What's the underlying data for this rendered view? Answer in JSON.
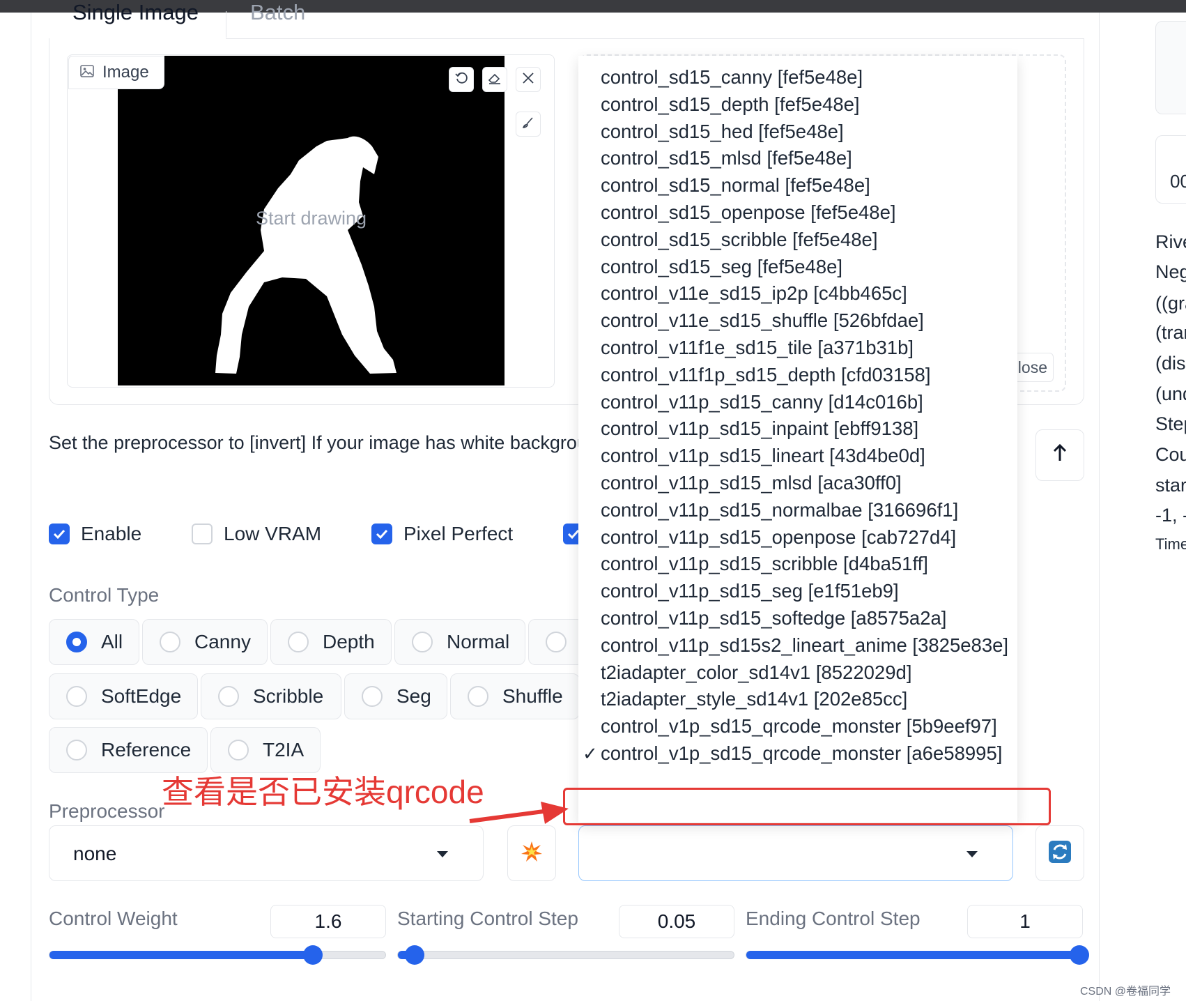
{
  "tabs": {
    "single": "Single Image",
    "batch": "Batch"
  },
  "image_panel": {
    "label": "Image",
    "placeholder": "Start drawing",
    "close_label": "lose"
  },
  "hint": "Set the preprocessor to [invert] If your image has white background and black lines.",
  "checkboxes": [
    {
      "label": "Enable",
      "checked": true
    },
    {
      "label": "Low VRAM",
      "checked": false
    },
    {
      "label": "Pixel Perfect",
      "checked": true
    }
  ],
  "control_type": {
    "label": "Control Type",
    "options": [
      "All",
      "Canny",
      "Depth",
      "Normal",
      "SoftEdge",
      "Scribble",
      "Seg",
      "Shuffle",
      "Reference",
      "T2IA"
    ],
    "selected": "All"
  },
  "preprocessor": {
    "label": "Preprocessor",
    "value": "none"
  },
  "model_dropdown": {
    "items": [
      "control_sd15_canny [fef5e48e]",
      "control_sd15_depth [fef5e48e]",
      "control_sd15_hed [fef5e48e]",
      "control_sd15_mlsd [fef5e48e]",
      "control_sd15_normal [fef5e48e]",
      "control_sd15_openpose [fef5e48e]",
      "control_sd15_scribble [fef5e48e]",
      "control_sd15_seg [fef5e48e]",
      "control_v11e_sd15_ip2p [c4bb465c]",
      "control_v11e_sd15_shuffle [526bfdae]",
      "control_v11f1e_sd15_tile [a371b31b]",
      "control_v11f1p_sd15_depth [cfd03158]",
      "control_v11p_sd15_canny [d14c016b]",
      "control_v11p_sd15_inpaint [ebff9138]",
      "control_v11p_sd15_lineart [43d4be0d]",
      "control_v11p_sd15_mlsd [aca30ff0]",
      "control_v11p_sd15_normalbae [316696f1]",
      "control_v11p_sd15_openpose [cab727d4]",
      "control_v11p_sd15_scribble [d4ba51ff]",
      "control_v11p_sd15_seg [e1f51eb9]",
      "control_v11p_sd15_softedge [a8575a2a]",
      "control_v11p_sd15s2_lineart_anime [3825e83e]",
      "t2iadapter_color_sd14v1 [8522029d]",
      "t2iadapter_style_sd14v1 [202e85cc]",
      "control_v1p_sd15_qrcode_monster [5b9eef97]",
      "control_v1p_sd15_qrcode_monster [a6e58995]"
    ],
    "selected_index": 25,
    "check_mark": "✓"
  },
  "annotation": "查看是否已安装qrcode",
  "sliders": {
    "weight": {
      "label": "Control Weight",
      "value": "1.6",
      "fraction": 0.78
    },
    "start": {
      "label": "Starting Control Step",
      "value": "0.05",
      "fraction": 0.05
    },
    "end": {
      "label": "Ending Control Step",
      "value": "1",
      "fraction": 1.0
    }
  },
  "right_panel": {
    "card_text": "00",
    "lines": [
      "Rive",
      "Neg",
      "((gra",
      "(tran",
      "(dis",
      "(und",
      "Step",
      "Cou",
      "star",
      "-1, -",
      "Time"
    ]
  },
  "watermark": "CSDN @卷福同学",
  "colors": {
    "accent": "#2563eb",
    "annotation": "#e53935"
  }
}
